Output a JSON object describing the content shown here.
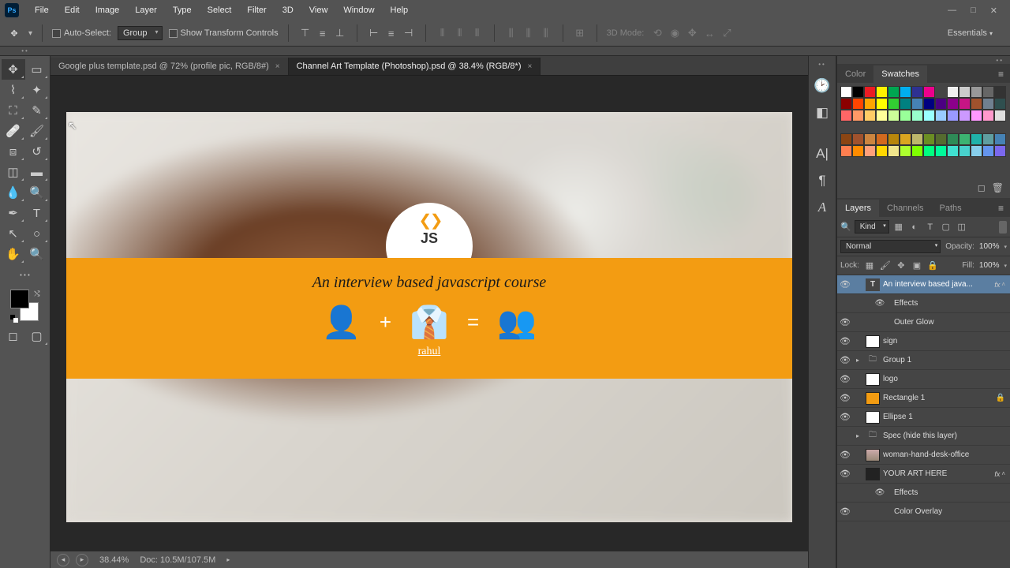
{
  "menu": [
    "File",
    "Edit",
    "Image",
    "Layer",
    "Type",
    "Select",
    "Filter",
    "3D",
    "View",
    "Window",
    "Help"
  ],
  "options": {
    "auto_select": "Auto-Select:",
    "group": "Group",
    "show_transform": "Show Transform Controls",
    "threeD": "3D Mode:"
  },
  "workspace": "Essentials",
  "tabs": [
    {
      "label": "Google plus template.psd @ 72% (profile pic, RGB/8#)",
      "active": false
    },
    {
      "label": "Channel Art Template (Photoshop).psd @ 38.4% (RGB/8*)",
      "active": true
    }
  ],
  "canvas": {
    "course_title": "An interview based javascript course",
    "logo_text": "JS",
    "sign": "rahul"
  },
  "status": {
    "zoom": "38.44%",
    "doc": "Doc: 10.5M/107.5M"
  },
  "panels": {
    "color_tab": "Color",
    "swatches_tab": "Swatches",
    "layers_tab": "Layers",
    "channels_tab": "Channels",
    "paths_tab": "Paths",
    "kind": "Kind",
    "blend": "Normal",
    "opacity_lbl": "Opacity:",
    "opacity_val": "100%",
    "lock_lbl": "Lock:",
    "fill_lbl": "Fill:",
    "fill_val": "100%"
  },
  "layers": [
    {
      "type": "text",
      "name": "An interview based java...",
      "active": true,
      "fx": true,
      "vis": true,
      "expanded": true
    },
    {
      "type": "fx-lbl",
      "name": "Effects"
    },
    {
      "type": "fx-item",
      "name": "Outer Glow"
    },
    {
      "type": "pixel",
      "name": "sign",
      "vis": true,
      "thumb": "white"
    },
    {
      "type": "group",
      "name": "Group 1",
      "vis": true,
      "collapsed": true
    },
    {
      "type": "pixel",
      "name": "logo",
      "vis": true,
      "thumb": "white"
    },
    {
      "type": "shape",
      "name": "Rectangle 1",
      "vis": true,
      "thumb": "orange",
      "locked": true
    },
    {
      "type": "shape",
      "name": "Ellipse 1",
      "vis": true,
      "thumb": "white"
    },
    {
      "type": "group",
      "name": "Spec (hide this layer)",
      "vis": false,
      "collapsed": true
    },
    {
      "type": "pixel",
      "name": "woman-hand-desk-office",
      "vis": true,
      "thumb": "photo"
    },
    {
      "type": "pixel",
      "name": "YOUR ART HERE",
      "vis": true,
      "thumb": "dark",
      "fx": true,
      "expanded": true
    },
    {
      "type": "fx-lbl",
      "name": "Effects"
    },
    {
      "type": "fx-item",
      "name": "Color Overlay"
    }
  ],
  "swatch_rows": [
    [
      "#ffffff",
      "#000000",
      "#ec1c24",
      "#fff200",
      "#00a651",
      "#00aeef",
      "#2e3192",
      "#ec008c",
      "",
      "#f0f0f0",
      "#cccccc",
      "#999999",
      "#666666",
      "#333333"
    ],
    [
      "#8b0000",
      "#ff4500",
      "#ffa500",
      "#ffff00",
      "#32cd32",
      "#008080",
      "#4682b4",
      "#000080",
      "#4b0082",
      "#8b008b",
      "#c71585",
      "#a0522d",
      "#708090",
      "#2f4f4f"
    ],
    [
      "#ff6666",
      "#ff9966",
      "#ffcc66",
      "#ffff99",
      "#ccff99",
      "#99ff99",
      "#99ffcc",
      "#99ffff",
      "#99ccff",
      "#9999ff",
      "#cc99ff",
      "#ff99ff",
      "#ff99cc",
      "#e0e0e0"
    ],
    [
      "",
      "",
      "",
      "",
      "",
      "",
      "",
      "",
      "",
      "",
      "",
      "",
      "",
      ""
    ],
    [
      "#8b4513",
      "#a0522d",
      "#cd853f",
      "#d2691e",
      "#b8860b",
      "#daa520",
      "#bdb76b",
      "#6b8e23",
      "#556b2f",
      "#2e8b57",
      "#3cb371",
      "#20b2aa",
      "#5f9ea0",
      "#4682b4"
    ],
    [
      "#ff7f50",
      "#ff8c00",
      "#ffa07a",
      "#ffd700",
      "#f0e68c",
      "#adff2f",
      "#7fff00",
      "#00ff7f",
      "#00fa9a",
      "#40e0d0",
      "#48d1cc",
      "#87ceeb",
      "#6495ed",
      "#7b68ee"
    ]
  ]
}
